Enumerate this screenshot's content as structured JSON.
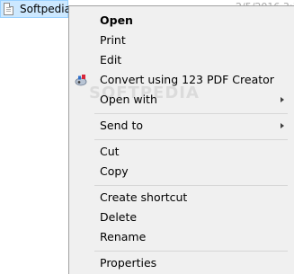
{
  "file": {
    "name": "Softpedia",
    "date": "2/5/2016 3:1",
    "icon": "document-icon"
  },
  "watermark": "SOFTPEDIA",
  "context_menu": {
    "items": [
      {
        "label": "Open",
        "bold": true
      },
      {
        "label": "Print"
      },
      {
        "label": "Edit"
      },
      {
        "label": "Convert using 123 PDF Creator",
        "icon": "pdf-creator-icon"
      },
      {
        "label": "Open with",
        "submenu": true
      },
      {
        "label": "Send to",
        "submenu": true
      },
      {
        "label": "Cut"
      },
      {
        "label": "Copy"
      },
      {
        "label": "Create shortcut"
      },
      {
        "label": "Delete"
      },
      {
        "label": "Rename"
      },
      {
        "label": "Properties"
      }
    ]
  },
  "colors": {
    "selection": "#cce8ff",
    "selection_border": "#99d1ff",
    "menu_background": "#f0f0f0",
    "menu_border": "#a0a0a0",
    "separator": "#d7d7d7"
  }
}
